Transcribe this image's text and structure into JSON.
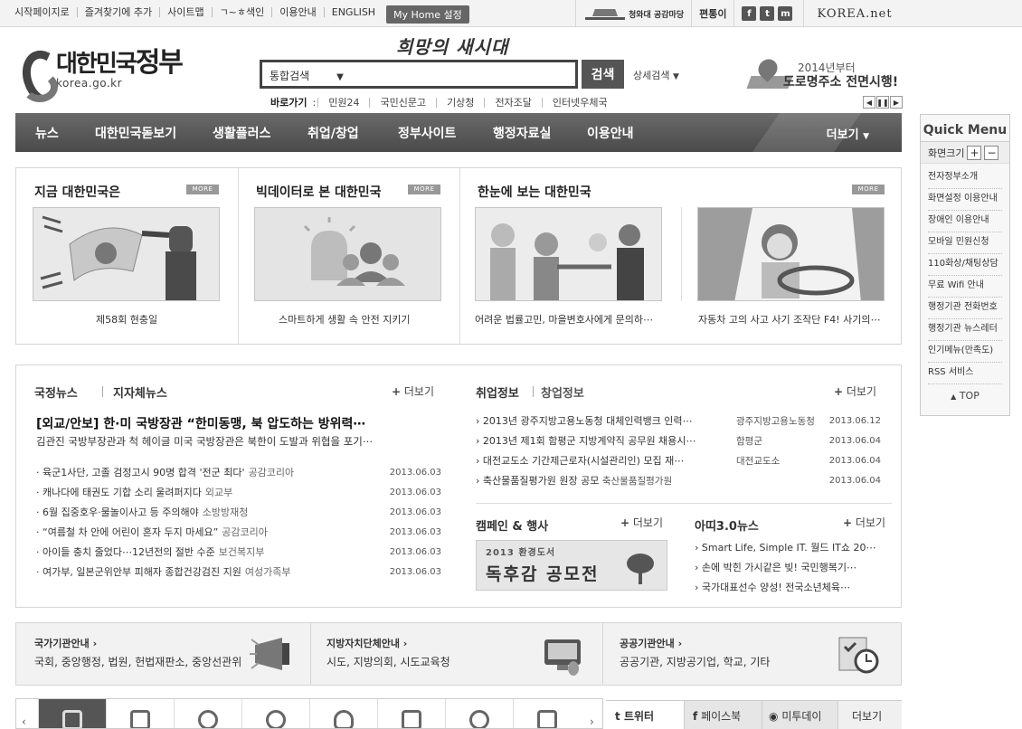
{
  "util": {
    "links": [
      "시작페이지로",
      "즐겨찾기에 추가",
      "사이트맵",
      "ㄱ~ㅎ색인",
      "이용안내",
      "ENGLISH"
    ],
    "myhome": "My Home 설정",
    "bluehouse": "청와대 공감마당",
    "pyeontong": "편통이",
    "sns": [
      "f",
      "t",
      "m"
    ],
    "koreanet": "KOREA.net"
  },
  "header": {
    "logo_ko_a": "대한민국",
    "logo_ko_b": "정부",
    "logo_en": "korea.go.kr",
    "slogan": "희망의 새시대",
    "search_scope": "통합검색",
    "search_button": "검색",
    "advanced_search": "상세검색",
    "quick_title": "바로가기",
    "quick_links": [
      "민원24",
      "국민신문고",
      "기상청",
      "전자조달",
      "인터넷우체국"
    ],
    "banner_line1": "2014년부터",
    "banner_line2": "도로명주소 전면시행!",
    "banner_controls": [
      "◀",
      "❚❚",
      "▶"
    ]
  },
  "nav": {
    "items": [
      "뉴스",
      "대한민국돋보기",
      "생활플러스",
      "취업/창업",
      "정부사이트",
      "행정자료실",
      "이용안내"
    ],
    "more": "더보기"
  },
  "quickmenu": {
    "title": "Quick Menu",
    "zoom_label": "화면크기",
    "zoom_in": "+",
    "zoom_out": "−",
    "items": [
      "전자정부소개",
      "화면설정 이용안내",
      "장애인 이용안내",
      "모바일 민원신청",
      "110화상/채팅상담",
      "무료 Wifi 안내",
      "행정기관 전화번호",
      "행정기관 뉴스레터",
      "인기메뉴(만족도)",
      "RSS 서비스"
    ],
    "top": "TOP"
  },
  "feature": {
    "more": "MORE",
    "sections": [
      {
        "title": "지금 대한민국은",
        "caption": "제58회 현충일"
      },
      {
        "title": "빅데이터로 본 대한민국",
        "caption": "스마트하게 생활 속 안전 지키기"
      },
      {
        "title": "한눈에 보는 대한민국",
        "caption": "어려운 법률고민, 마을변호사에게 문의하⋯"
      },
      {
        "title": "",
        "caption": "자동차 고의 사고 사기 조작단 F4! 사기의⋯"
      }
    ]
  },
  "news": {
    "tab1": "국정뉴스",
    "tab2": "지자체뉴스",
    "more": "더보기",
    "headline": "[외교/안보] 한·미 국방장관 “한미동맹, 북 압도하는 방위력⋯",
    "subline": "김관진 국방부장관과 척 헤이글 미국 국방장관은 북한이 도발과 위협을 포기⋯",
    "items": [
      {
        "title": "육군1사단, 고졸 검정고시 90명 합격 '전군 최다'",
        "source": "공감코리아",
        "date": "2013.06.03"
      },
      {
        "title": "캐나다에 태권도 기합 소리 울려퍼지다",
        "source": "외교부",
        "date": "2013.06.03"
      },
      {
        "title": "6월 집중호우·물놀이사고 등 주의해야",
        "source": "소방방재청",
        "date": "2013.06.03"
      },
      {
        "title": "“여름철 차 안에 어린이 혼자 두지 마세요”",
        "source": "공감코리아",
        "date": "2013.06.03"
      },
      {
        "title": "아이들 충치 줄었다⋯12년전의 절반 수준",
        "source": "보건복지부",
        "date": "2013.06.03"
      },
      {
        "title": "여가부, 일본군위안부 피해자 종합건강검진 지원",
        "source": "여성가족부",
        "date": "2013.06.03"
      }
    ]
  },
  "jobs": {
    "tab1": "취업정보",
    "tab2": "창업정보",
    "more": "더보기",
    "items": [
      {
        "title": "2013년 광주지방고용노동청 대체인력뱅크 인력⋯",
        "source": "광주지방고용노동청",
        "date": "2013.06.12"
      },
      {
        "title": "2013년 제1회 함평군 지방계약직 공무원 채용시⋯",
        "source": "함평군",
        "date": "2013.06.04"
      },
      {
        "title": "대전교도소 기간제근로자(시설관리인) 모집 재⋯",
        "source": "대전교도소",
        "date": "2013.06.04"
      },
      {
        "title": "축산물품질평가원 원장 공모",
        "source": "축산물품질평가원",
        "date": "2013.06.04"
      }
    ]
  },
  "campaign": {
    "title": "캠페인 & 행사",
    "more": "더보기",
    "banner_line1": "2013 환경도서",
    "banner_line2": "독후감 공모전"
  },
  "aphi": {
    "title": "아띠3.0뉴스",
    "more": "더보기",
    "items": [
      "Smart Life, Simple IT. 월드 IT쇼 20⋯",
      "손에 박힌 가시같은 빚! 국민행복기⋯",
      "국가대표선수 양성! 전국소년체육⋯"
    ]
  },
  "orgs": [
    {
      "title": "국가기관안내",
      "desc": "국회, 중앙행정, 법원, 헌법재판소, 중앙선관위"
    },
    {
      "title": "지방자치단체안내",
      "desc": "시도, 지방의회, 시도교육청"
    },
    {
      "title": "공공기관안내",
      "desc": "공공기관, 지방공기업, 학교, 기타"
    }
  ],
  "social": {
    "twitter": "트위터",
    "facebook": "페이스북",
    "me2day": "미투데이",
    "more": "더보기"
  }
}
